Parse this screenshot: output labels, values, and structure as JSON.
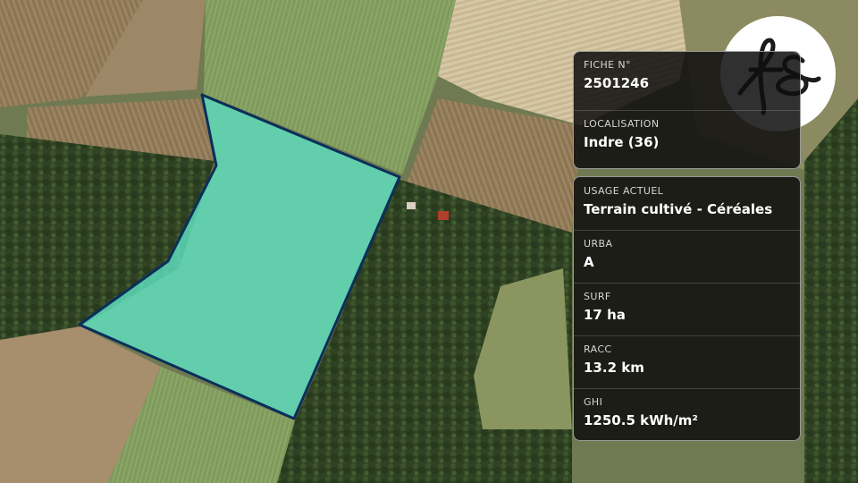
{
  "map": {
    "layer": "satellite",
    "parcel_fill": "#5fe0bf",
    "parcel_stroke": "#0b2f5a"
  },
  "logo": {
    "text": "fs",
    "icon": "fs-monogram-logo"
  },
  "info_top": [
    {
      "label": "FICHE N°",
      "value": "2501246"
    },
    {
      "label": "LOCALISATION",
      "value": "Indre (36)"
    }
  ],
  "info_bottom": [
    {
      "label": "USAGE ACTUEL",
      "value": "Terrain cultivé - Céréales"
    },
    {
      "label": "URBA",
      "value": "A"
    },
    {
      "label": "SURF",
      "value": "17 ha"
    },
    {
      "label": "RACC",
      "value": "13.2 km"
    },
    {
      "label": "GHI",
      "value": "1250.5 kWh/m²"
    }
  ]
}
